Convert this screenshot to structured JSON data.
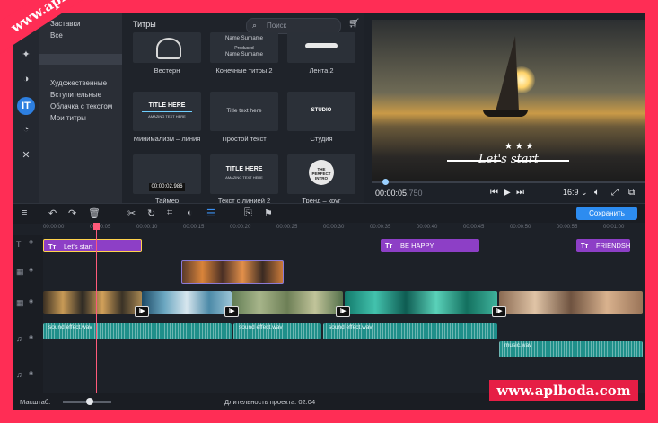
{
  "categories": {
    "items": [
      "Заставки",
      "Все",
      "",
      "",
      "",
      "Художественные",
      "Вступительные",
      "Облачка с текстом",
      "Мои титры"
    ]
  },
  "titles_panel": {
    "header": "Титры",
    "search_placeholder": "Поиск",
    "tiles": [
      {
        "label": "Вестерн",
        "text": "",
        "sub": ""
      },
      {
        "label": "Конечные титры 2",
        "text": "Name Surname",
        "sub": "Produced\nName Surname"
      },
      {
        "label": "Лента 2",
        "text": "",
        "sub": ""
      },
      {
        "label": "Минимализм – линия",
        "text": "TITLE HERE",
        "sub": "AMAZING TEXT HERE"
      },
      {
        "label": "Простой текст",
        "text": "Title text here",
        "sub": ""
      },
      {
        "label": "Студия",
        "text": "STUDIO",
        "sub": ""
      },
      {
        "label": "Таймер",
        "text": "00:00:02.986",
        "sub": ""
      },
      {
        "label": "Текст с линией 2",
        "text": "TITLE HERE",
        "sub": "AMAZING TEXT HERE"
      },
      {
        "label": "Тренд – круг",
        "text": "THE PERFECT INTRO",
        "sub": ""
      }
    ]
  },
  "preview": {
    "overlay_text": "Let's start",
    "timecode_main": "00:00:05",
    "timecode_frac": ".750",
    "aspect": "16:9",
    "progress_fraction": 0.05
  },
  "toolbar": {
    "save_label": "Сохранить"
  },
  "ruler": {
    "ticks": [
      "00:00:00",
      "00:00:05",
      "00:00:10",
      "00:00:15",
      "00:00:20",
      "00:00:25",
      "00:00:30",
      "00:00:35",
      "00:00:40",
      "00:00:45",
      "00:00:50",
      "00:00:55",
      "00:01:00"
    ]
  },
  "timeline": {
    "title_clips": [
      "Let's start",
      "BE HAPPY",
      "FRIENDSHIP"
    ],
    "audio_clips": [
      "sound effect.wav",
      "sound effect.wav",
      "sound effect.wav",
      "music.wav"
    ],
    "transition_label": "I▶"
  },
  "bottom": {
    "scale_label": "Масштаб:",
    "duration_label": "Длительность проекта:",
    "duration_value": "02:04"
  },
  "watermark": "www.aplboda.com",
  "colors": {
    "accent": "#2d8cf0",
    "title_clip": "#8d3fc6",
    "audio_clip": "#1f8f8a",
    "playhead": "#ff5a7a",
    "frame": "#ff2d55"
  }
}
